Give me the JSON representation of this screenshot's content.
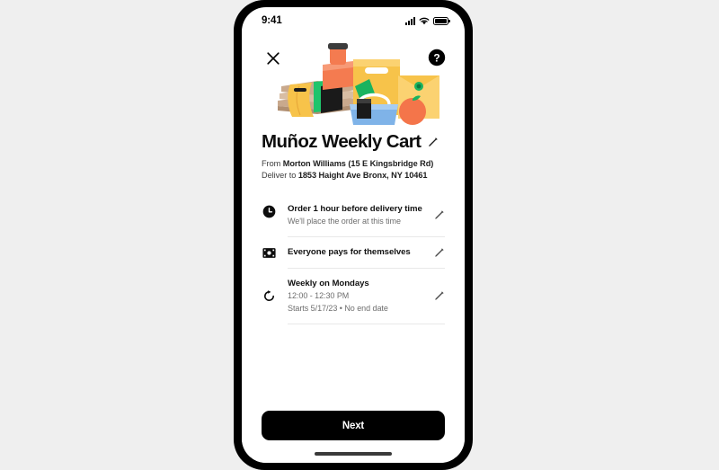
{
  "status_bar": {
    "time": "9:41",
    "signal_icon": "cellular-signal-icon",
    "wifi_icon": "wifi-icon",
    "battery_icon": "battery-icon"
  },
  "header": {
    "close_icon": "close-icon",
    "help_icon": "help-circle-icon",
    "illustration": "grocery-bags-illustration"
  },
  "cart": {
    "title": "Muñoz Weekly Cart",
    "title_edit_icon": "pencil-icon",
    "from_prefix": "From ",
    "from_store": "Morton Williams (15 E Kingsbridge Rd)",
    "deliver_prefix": "Deliver to ",
    "deliver_address": "1853 Haight Ave Bronx, NY 10461"
  },
  "rows": [
    {
      "icon": "clock-icon",
      "title": "Order 1 hour before delivery time",
      "sub1": "We'll place the order at this time",
      "sub2": "",
      "edit_icon": "pencil-icon"
    },
    {
      "icon": "payment-card-icon",
      "title": "Everyone pays for themselves",
      "sub1": "",
      "sub2": "",
      "edit_icon": "pencil-icon"
    },
    {
      "icon": "repeat-icon",
      "title": "Weekly on Mondays",
      "sub1": "12:00 - 12:30 PM",
      "sub2": "Starts 5/17/23 • No end date",
      "edit_icon": "pencil-icon"
    }
  ],
  "footer": {
    "next_label": "Next",
    "home_indicator": "home-indicator"
  },
  "colors": {
    "page_background": "#efefef",
    "phone_frame": "#000000",
    "screen": "#ffffff",
    "primary_text": "#0d0d0d",
    "secondary_text": "#6e6e6e",
    "divider": "#e8e8e8",
    "button": "#000000",
    "illustration_yellow": "#f7c34a",
    "illustration_orange": "#f47b50",
    "illustration_green": "#19b35f",
    "illustration_blue": "#7fb3e8"
  }
}
